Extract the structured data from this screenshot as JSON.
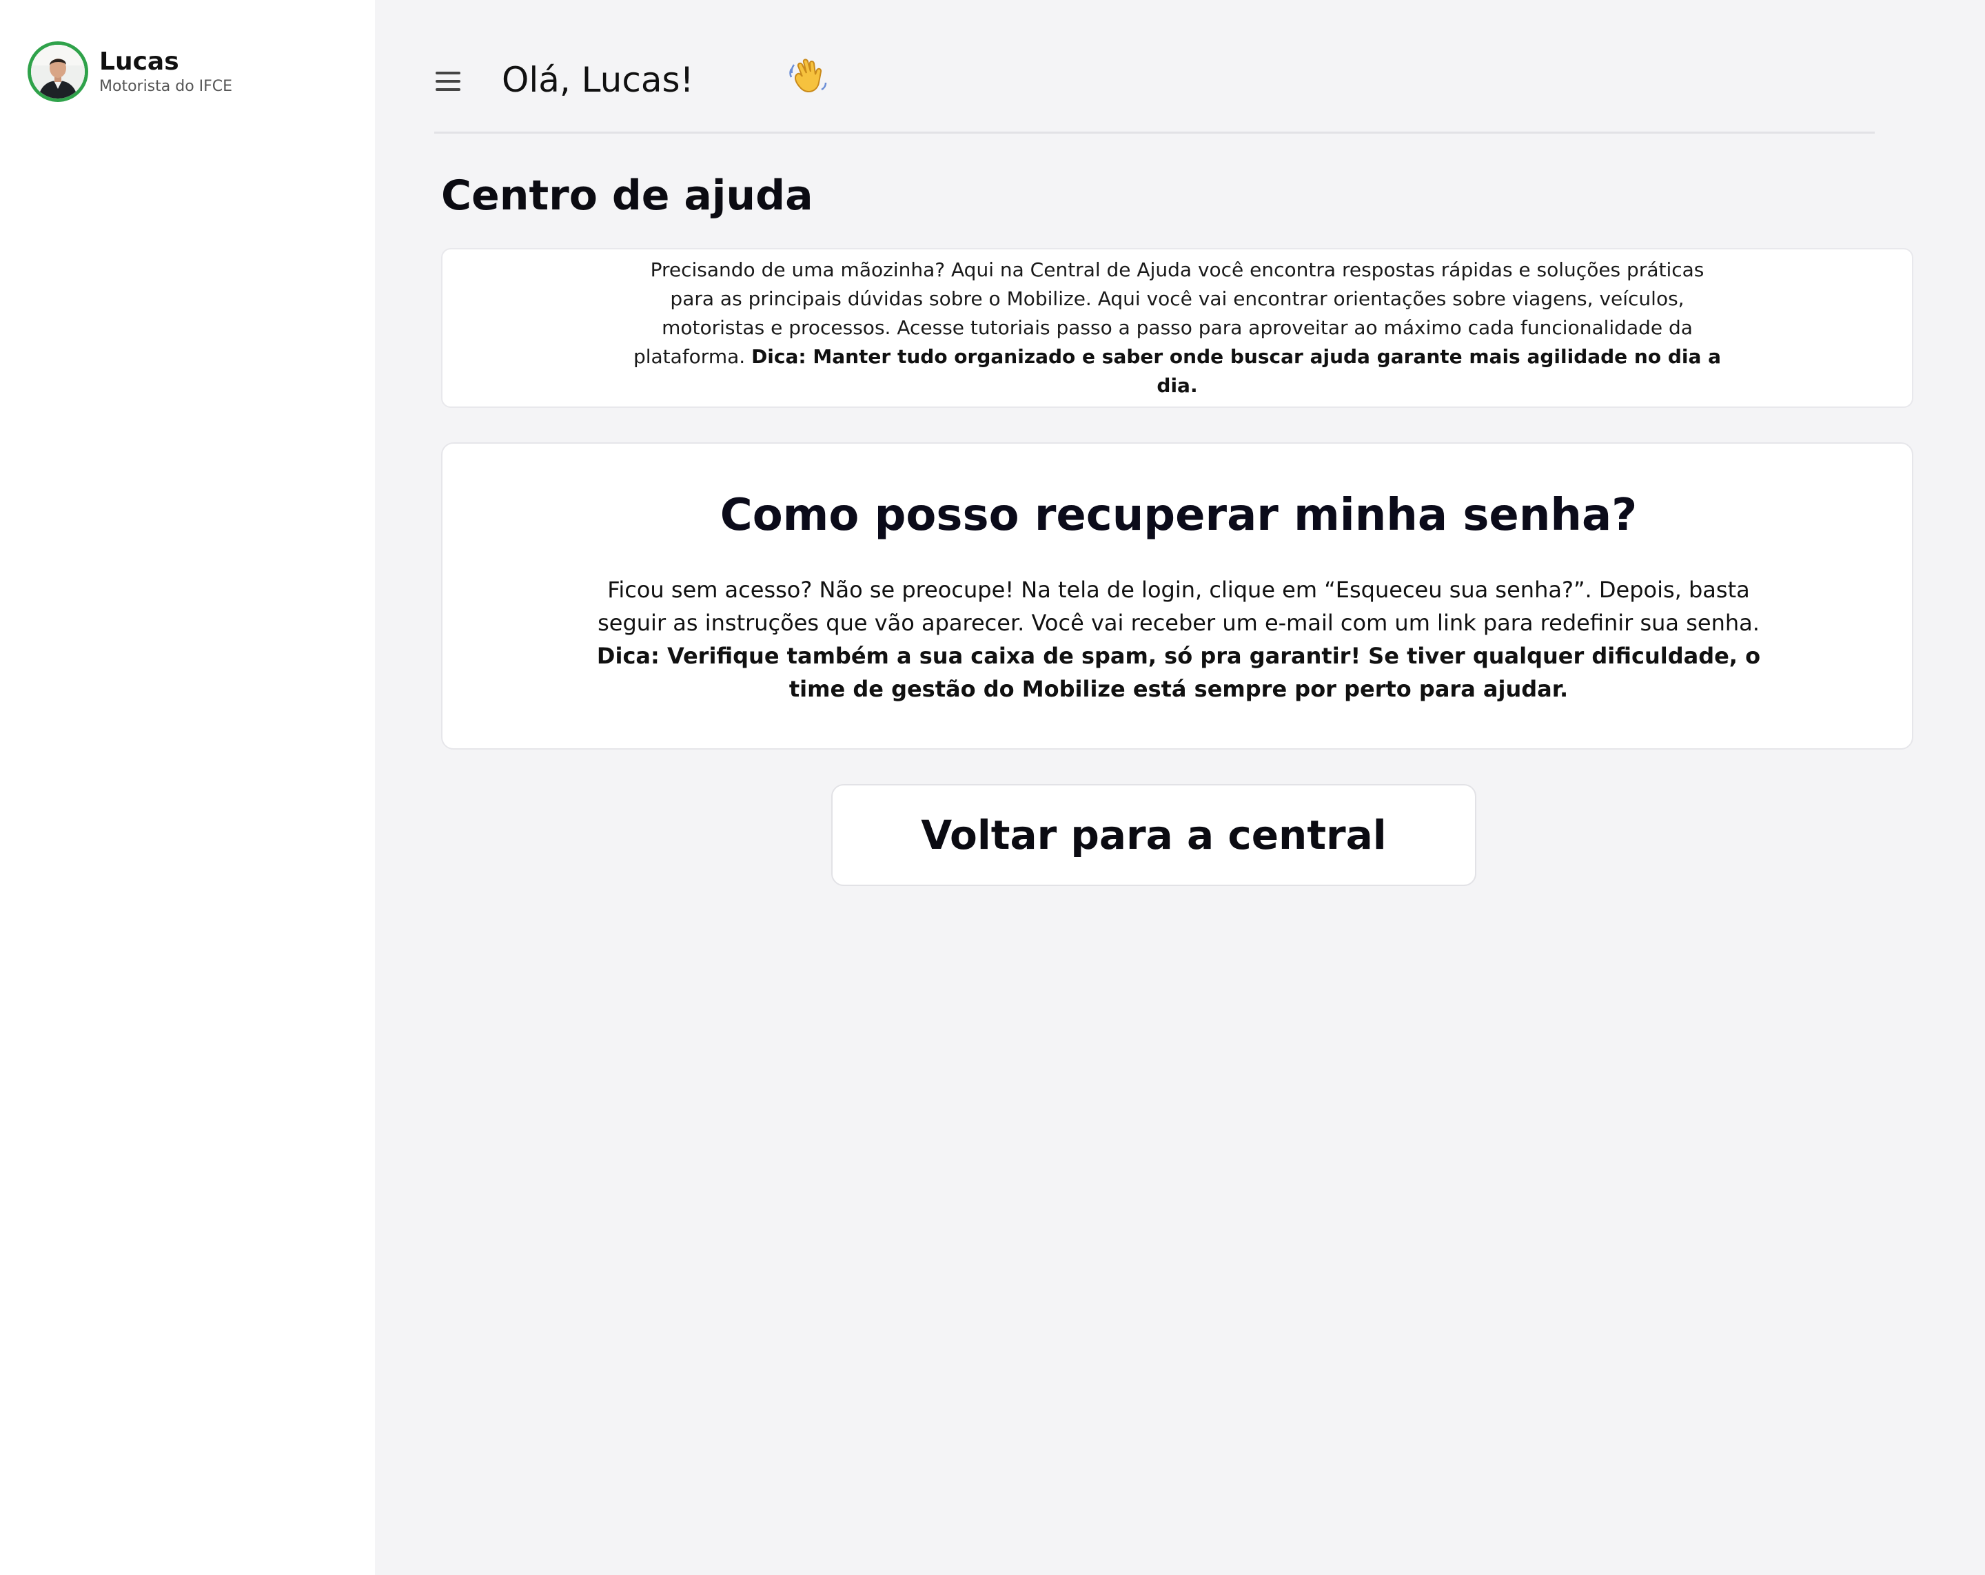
{
  "user": {
    "name": "Lucas",
    "role": "Motorista do IFCE",
    "avatar_accent": "#2fa24a"
  },
  "header": {
    "greeting": "Olá, Lucas!",
    "wave_emoji": "👋",
    "menu_icon": "hamburger-menu-icon"
  },
  "page": {
    "title": "Centro de ajuda"
  },
  "intro": {
    "text": "Precisando de uma mãozinha? Aqui na Central de Ajuda você encontra respostas rápidas e soluções práticas para as principais dúvidas sobre o Mobilize. Aqui você vai encontrar orientações sobre viagens, veículos, motoristas e processos. Acesse tutoriais passo a passo para aproveitar ao máximo cada funcionalidade da plataforma. ",
    "tip": "Dica: Manter tudo organizado e saber onde buscar ajuda garante mais agilidade no dia a dia."
  },
  "faq": {
    "question": "Como posso recuperar minha senha?",
    "answer": "Ficou sem acesso? Não se preocupe! Na tela de login, clique em “Esqueceu sua senha?”. Depois, basta seguir as instruções que vão aparecer. Você vai receber um e-mail com um link para redefinir sua senha. ",
    "tip": "Dica: Verifique também a sua caixa de spam, só pra garantir! Se tiver qualquer dificuldade, o time de gestão do Mobilize está sempre por perto para ajudar."
  },
  "actions": {
    "back_label": "Voltar para a central"
  }
}
